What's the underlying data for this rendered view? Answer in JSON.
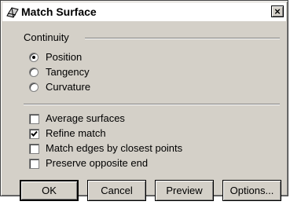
{
  "window": {
    "title": "Match Surface",
    "close_label": "×"
  },
  "continuity": {
    "label": "Continuity",
    "options": [
      {
        "label": "Position",
        "selected": true
      },
      {
        "label": "Tangency",
        "selected": false
      },
      {
        "label": "Curvature",
        "selected": false
      }
    ]
  },
  "options": [
    {
      "label": "Average surfaces",
      "checked": false
    },
    {
      "label": "Refine match",
      "checked": true
    },
    {
      "label": "Match edges by closest points",
      "checked": false
    },
    {
      "label": "Preserve opposite end",
      "checked": false
    }
  ],
  "buttons": {
    "ok": "OK",
    "cancel": "Cancel",
    "preview": "Preview",
    "options": "Options..."
  }
}
